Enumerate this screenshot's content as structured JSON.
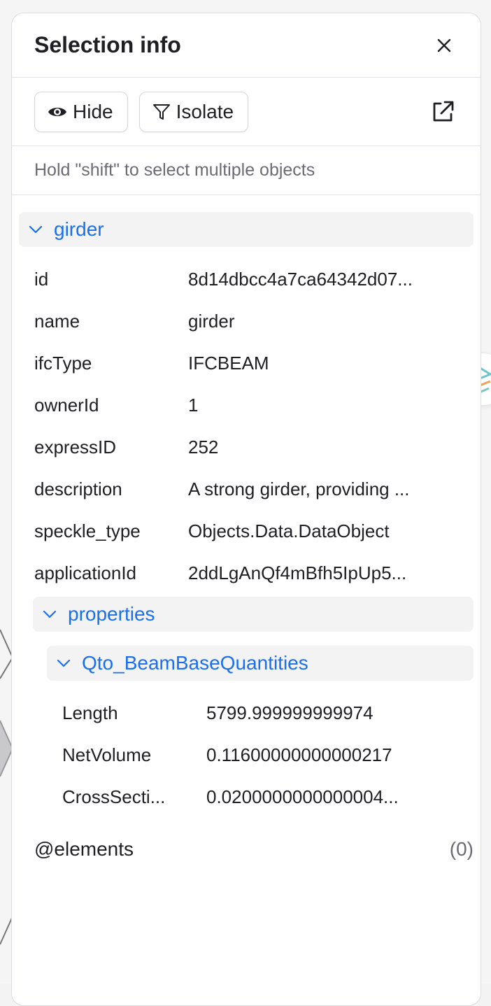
{
  "panel": {
    "title": "Selection info",
    "toolbar": {
      "hide_label": "Hide",
      "isolate_label": "Isolate"
    },
    "hint": "Hold \"shift\" to select multiple objects"
  },
  "object": {
    "name": "girder",
    "fields": [
      {
        "key": "id",
        "value": "8d14dbcc4a7ca64342d07..."
      },
      {
        "key": "name",
        "value": "girder"
      },
      {
        "key": "ifcType",
        "value": "IFCBEAM"
      },
      {
        "key": "ownerId",
        "value": "1"
      },
      {
        "key": "expressID",
        "value": "252"
      },
      {
        "key": "description",
        "value": "A strong girder, providing ..."
      },
      {
        "key": "speckle_type",
        "value": "Objects.Data.DataObject"
      },
      {
        "key": "applicationId",
        "value": "2ddLgAnQf4mBfh5IpUp5..."
      }
    ],
    "properties": {
      "label": "properties",
      "group": {
        "label": "Qto_BeamBaseQuantities",
        "fields": [
          {
            "key": "Length",
            "value": "5799.999999999974"
          },
          {
            "key": "NetVolume",
            "value": "0.11600000000000217"
          },
          {
            "key": "CrossSecti...",
            "value": "0.0200000000000004..."
          }
        ]
      }
    },
    "elements": {
      "label": "@elements",
      "count": "(0)"
    }
  },
  "colors": {
    "accent": "#1a6ff0",
    "text": "#1f1f23",
    "muted": "#6b6b73",
    "group_bg": "#f3f3f4"
  },
  "icons": [
    "close-icon",
    "eye-icon",
    "filter-icon",
    "external-link-icon",
    "chevron-down-icon",
    "speckle-logo-icon"
  ]
}
